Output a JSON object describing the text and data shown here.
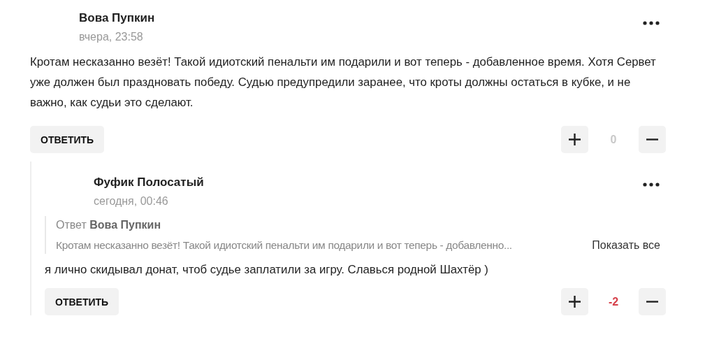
{
  "comments": [
    {
      "author": "Вова Пупкин",
      "time": "вчера, 23:58",
      "text": "Кротам несказанно везёт! Такой идиотский пенальти им подарили и вот теперь - добавленное время. Хотя Сервет уже должен был праздновать победу. Судью предупредили заранее, что кроты должны остаться в кубке, и не важно, как судьи это сделают.",
      "reply_button": "ОТВЕТИТЬ",
      "score": "0",
      "color": "#c8c8c8",
      "replies": [
        {
          "author": "Фуфик Полосатый",
          "time": "сегодня, 00:46",
          "quote": {
            "label": "Ответ",
            "author": "Вова Пупкин",
            "text": "Кротам несказанно везёт! Такой идиотский пенальти им подарили и вот теперь - добавленно...",
            "action": "Показать все"
          },
          "text": "я лично скидывал донат, чтоб судье заплатили за игру. Славься родной Шахтёр )",
          "reply_button": "ОТВЕТИТЬ",
          "score": "-2",
          "color": "#d6404a"
        }
      ]
    }
  ]
}
